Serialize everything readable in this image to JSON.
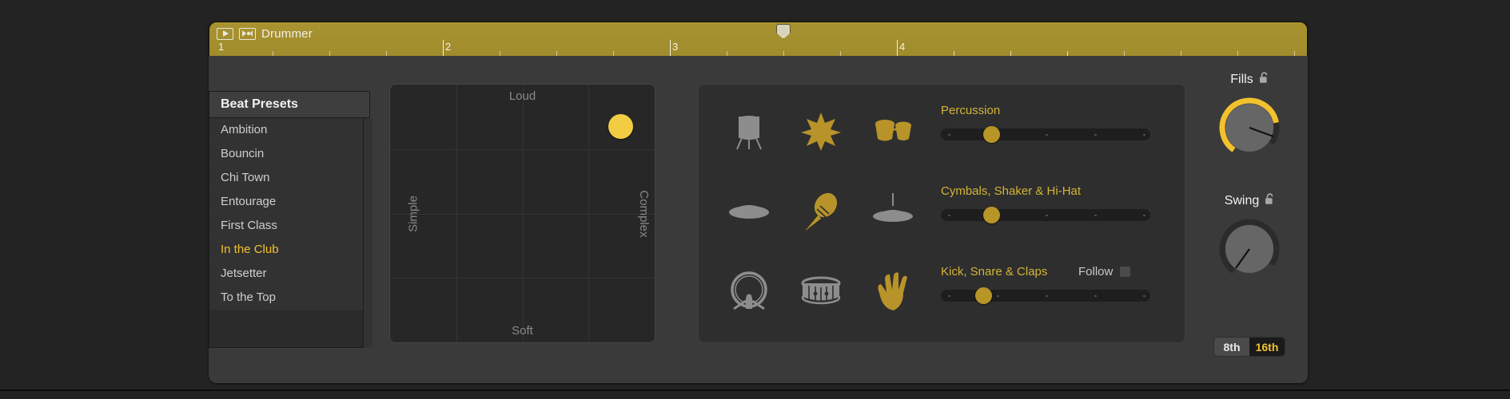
{
  "window": {
    "background_color": "#232323"
  },
  "region": {
    "title": "Drummer",
    "play_icon": "play-icon",
    "drummer_icon": "drummer-region-icon",
    "accent_color": "#a99331",
    "ruler": {
      "bars": [
        "1",
        "2",
        "3",
        "4"
      ],
      "playhead_bar": "3.5"
    }
  },
  "presets": {
    "header": "Beat Presets",
    "selected": "In the Club",
    "items": [
      {
        "label": "Ambition"
      },
      {
        "label": "Bouncin"
      },
      {
        "label": "Chi Town"
      },
      {
        "label": "Entourage"
      },
      {
        "label": "First Class"
      },
      {
        "label": "In the Club"
      },
      {
        "label": "Jetsetter"
      },
      {
        "label": "To the Top"
      }
    ]
  },
  "xy_pad": {
    "top_label": "Loud",
    "bottom_label": "Soft",
    "left_label": "Simple",
    "right_label": "Complex",
    "puck_color": "#f2cc43",
    "puck_x_pct": 87,
    "puck_y_pct": 16,
    "grid_divisions": 4
  },
  "kit": {
    "rows": [
      {
        "label": "Percussion",
        "label_color": "#d4b437",
        "icons": [
          "tambourine-stand-icon",
          "shaker-burst-icon",
          "bongos-icon"
        ],
        "icon_states": [
          "off",
          "on",
          "on"
        ],
        "slider_value_pct": 22,
        "slider_ticks": 4,
        "has_follow": false
      },
      {
        "label": "Cymbals, Shaker & Hi-Hat",
        "label_color": "#d4b437",
        "icons": [
          "cymbal-icon",
          "maraca-icon",
          "hihat-icon"
        ],
        "icon_states": [
          "off",
          "on",
          "off"
        ],
        "slider_value_pct": 22,
        "slider_ticks": 4,
        "has_follow": false
      },
      {
        "label": "Kick, Snare & Claps",
        "label_color": "#d4b437",
        "icons": [
          "kick-drum-icon",
          "snare-drum-icon",
          "clap-hand-icon"
        ],
        "icon_states": [
          "off",
          "off",
          "on"
        ],
        "slider_value_pct": 18,
        "slider_ticks": 4,
        "has_follow": true,
        "follow_label": "Follow",
        "follow_checked": false
      }
    ]
  },
  "knobs": {
    "fills": {
      "label": "Fills",
      "lock_icon": "lock-open-icon",
      "locked": false,
      "value_pct": 62,
      "arc_color": "#f2c22e"
    },
    "swing": {
      "label": "Swing",
      "lock_icon": "lock-open-icon",
      "locked": false,
      "value_pct": 0,
      "arc_color": "#f2c22e"
    }
  },
  "note_division": {
    "options": [
      "8th",
      "16th"
    ],
    "selected": "16th"
  }
}
